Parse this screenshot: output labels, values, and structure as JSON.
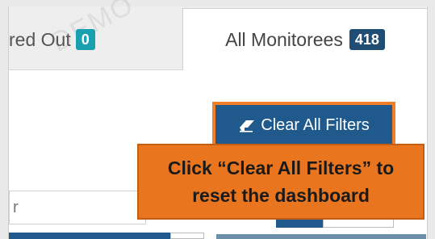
{
  "tabs": {
    "cleared": {
      "label_partial": "red Out",
      "count": "0"
    },
    "all": {
      "label": "All Monitorees",
      "count": "418"
    }
  },
  "watermark": "DEMO",
  "toolbar": {
    "clear_all_filters_label": "Clear All Filters",
    "clear_icon": "eraser-icon"
  },
  "callout": {
    "line1": "Click “Clear All Filters” to",
    "line2": "reset the dashboard"
  },
  "search": {
    "partial_label": "r"
  },
  "colors": {
    "primary": "#205a8c",
    "badge_teal": "#1a9fb1",
    "badge_navy": "#1f4d73",
    "callout_orange": "#e9761f",
    "highlight_orange": "#f07f2a"
  }
}
